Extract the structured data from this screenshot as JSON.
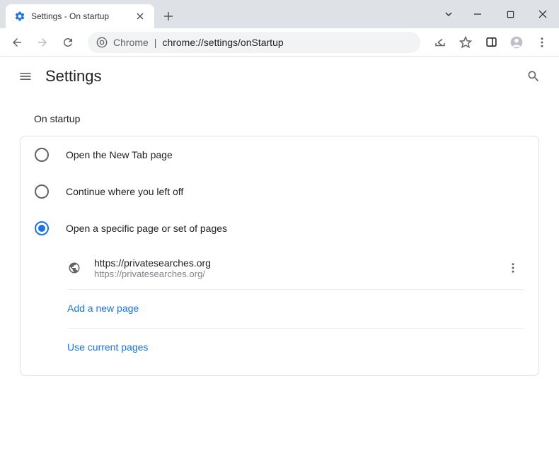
{
  "window": {
    "tab_title": "Settings - On startup"
  },
  "address": {
    "label": "Chrome",
    "url": "chrome://settings/onStartup"
  },
  "header": {
    "title": "Settings"
  },
  "section": {
    "title": "On startup",
    "options": [
      {
        "label": "Open the New Tab page",
        "selected": false
      },
      {
        "label": "Continue where you left off",
        "selected": false
      },
      {
        "label": "Open a specific page or set of pages",
        "selected": true
      }
    ],
    "pages": [
      {
        "title": "https://privatesearches.org",
        "url": "https://privatesearches.org/"
      }
    ],
    "add_link": "Add a new page",
    "use_current_link": "Use current pages"
  }
}
